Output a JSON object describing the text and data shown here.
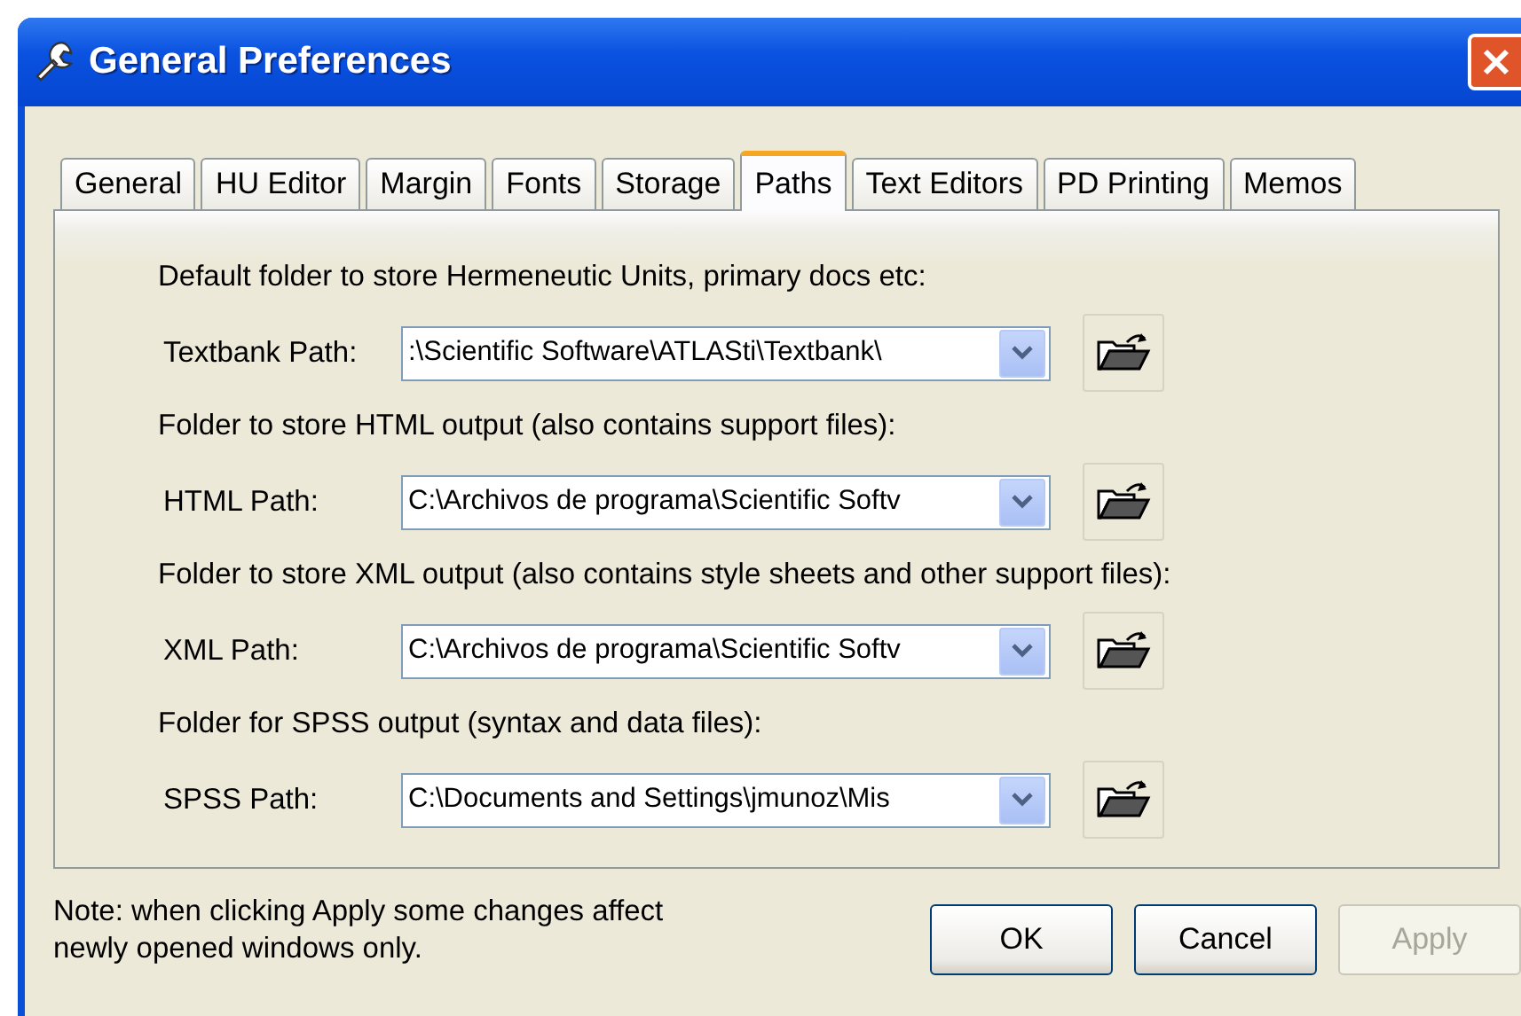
{
  "window": {
    "title": "General Preferences"
  },
  "tabs": [
    {
      "label": "General",
      "selected": false
    },
    {
      "label": "HU Editor",
      "selected": false
    },
    {
      "label": "Margin",
      "selected": false
    },
    {
      "label": "Fonts",
      "selected": false
    },
    {
      "label": "Storage",
      "selected": false
    },
    {
      "label": "Paths",
      "selected": true
    },
    {
      "label": "Text Editors",
      "selected": false
    },
    {
      "label": "PD Printing",
      "selected": false
    },
    {
      "label": "Memos",
      "selected": false
    }
  ],
  "paths": [
    {
      "heading": "Default folder to store Hermeneutic Units, primary docs etc:",
      "label": "Textbank Path:",
      "value": ":\\Scientific Software\\ATLASti\\Textbank\\"
    },
    {
      "heading": "Folder to store HTML output (also contains support files):",
      "label": "HTML Path:",
      "value": "C:\\Archivos de programa\\Scientific Softv"
    },
    {
      "heading": "Folder to store XML output (also contains style sheets and other support files):",
      "label": "XML Path:",
      "value": "C:\\Archivos de programa\\Scientific Softv"
    },
    {
      "heading": "Folder for SPSS output (syntax and data files):",
      "label": "SPSS Path:",
      "value": "C:\\Documents and Settings\\jmunoz\\Mis"
    }
  ],
  "note": "Note: when clicking Apply some changes affect newly opened windows only.",
  "buttons": [
    {
      "label": "OK",
      "disabled": false
    },
    {
      "label": "Cancel",
      "disabled": false
    },
    {
      "label": "Apply",
      "disabled": true
    }
  ]
}
